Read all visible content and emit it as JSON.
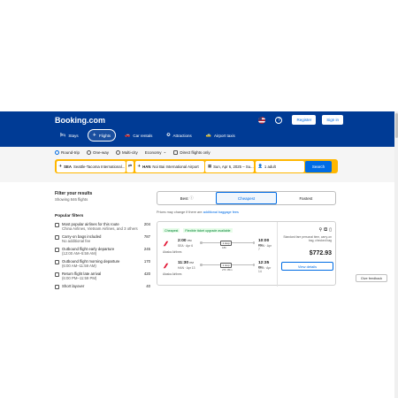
{
  "header": {
    "logo": "Booking.com",
    "register": "Register",
    "signin": "Sign in",
    "help": "?",
    "nav": [
      {
        "label": "Stays",
        "icon": "bed-icon",
        "glyph": "🛏"
      },
      {
        "label": "Flights",
        "icon": "plane-icon",
        "glyph": "✈"
      },
      {
        "label": "Car rentals",
        "icon": "car-icon",
        "glyph": "🚗"
      },
      {
        "label": "Attractions",
        "icon": "attractions-icon",
        "glyph": "✪"
      },
      {
        "label": "Airport taxis",
        "icon": "taxi-icon",
        "glyph": "🚕"
      }
    ]
  },
  "search": {
    "trip_types": [
      "Round-trip",
      "One-way",
      "Multi-city"
    ],
    "cabin": "Economy",
    "direct_only": "Direct flights only",
    "from_code": "SEA",
    "from_name": "Seattle-Tacoma International...",
    "to_code": "HAN",
    "to_name": "Noi Bai International Airport",
    "dates": "Sun, Apr 6, 2025 – Su...",
    "travelers": "1 adult",
    "button": "Search"
  },
  "filters": {
    "title": "Filter your results",
    "subtitle": "Showing 846 flights",
    "popular_heading": "Popular filters",
    "items": [
      {
        "label": "Most popular airlines for this route",
        "desc": "China Airlines, Vietnam Airlines, and 3 others",
        "count": "204"
      },
      {
        "label": "Carry-on bags included",
        "desc": "No additional fee",
        "count": "787"
      },
      {
        "label": "Outbound flight early departure",
        "desc": "(12:00 AM–5:59 AM)",
        "count": "245"
      },
      {
        "label": "Outbound flight morning departure",
        "desc": "(6:00 AM–11:59 AM)",
        "count": "170"
      },
      {
        "label": "Return flight late arrival",
        "desc": "(6:00 PM–11:59 PM)",
        "count": "420"
      },
      {
        "label": "Short layover",
        "desc": "",
        "count": "40"
      }
    ]
  },
  "sort": {
    "best": "Best",
    "cheapest": "Cheapest",
    "fastest": "Fastest",
    "info": "ⓘ"
  },
  "note": {
    "text": "Prices may change if there are ",
    "link": "additional baggage fees"
  },
  "result": {
    "badge_cheapest": "Cheapest",
    "badge_flex": "Flexible ticket upgrade available",
    "legs": [
      {
        "dep_time": "2:00",
        "dep_ampu": "PM",
        "dep_info": "SEA · Apr 6",
        "stop": "1 stop",
        "duration": "18h",
        "arr_time": "10:00",
        "arr_ampu": "PM",
        "arr_info": "HAN · Apr 7",
        "airline": "Alaska Airlines"
      },
      {
        "dep_time": "11:30",
        "dep_ampu": "PM",
        "dep_info": "HAN · Apr 13",
        "stop": "1 stop",
        "duration": "27h 05m",
        "arr_time": "12:35",
        "arr_ampu": "PM",
        "arr_info": "SEA · Apr 14",
        "airline": "Alaska Airlines"
      }
    ],
    "bag_text": "Standard fare personal item, carry-on bag, checked bag",
    "price": "$772.93",
    "view_details": "View details"
  },
  "feedback": "Give feedback",
  "colors": {
    "brand": "#003b95",
    "accent": "#006ce4",
    "search_border": "#ffb700",
    "airline_red": "#e31837"
  }
}
